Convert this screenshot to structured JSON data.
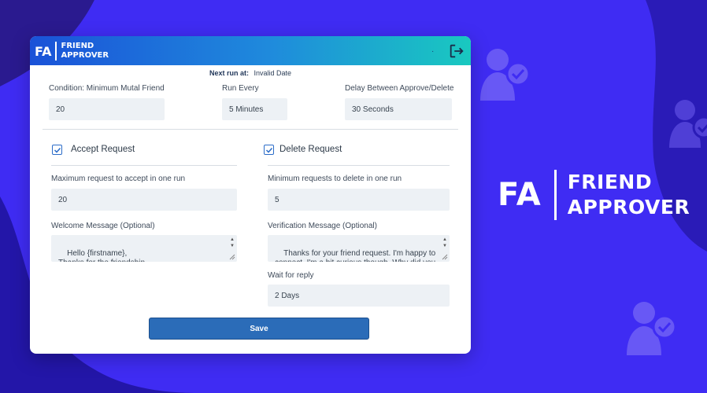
{
  "brand": {
    "initials": "FA",
    "line1": "FRIEND",
    "line2": "APPROVER"
  },
  "app": {
    "logo": {
      "initials": "FA",
      "line1": "FRIEND",
      "line2": "APPROVER"
    },
    "logout_icon": "logout-icon",
    "next_run": {
      "label": "Next run at:",
      "value": "Invalid Date"
    },
    "settings": {
      "condition_label": "Condition: Minimum Mutal Friend",
      "condition_value": "20",
      "run_every_label": "Run Every",
      "run_every_value": "5 Minutes",
      "delay_label": "Delay Between Approve/Delete",
      "delay_value": "30 Seconds"
    },
    "accept": {
      "checkbox_label": "Accept Request",
      "checked": true,
      "max_label": "Maximum request to accept in one run",
      "max_value": "20",
      "message_label": "Welcome Message (Optional)",
      "message_value": "Hello {firstname},\nThanks for the friendship\nHow are you doing?"
    },
    "delete": {
      "checkbox_label": "Delete Request",
      "checked": true,
      "min_label": "Minimum requests to delete in one run",
      "min_value": "5",
      "message_label": "Verification Message (Optional)",
      "message_value": "Thanks for your friend request. I'm happy to connect. I'm a bit curious though. Why did you send me a friend request? Just wondering",
      "wait_label": "Wait for reply",
      "wait_value": "2 Days"
    },
    "save_label": "Save"
  },
  "colors": {
    "background": "#3f2cf3",
    "dark_corner": "#2a1a8f",
    "accent": "#2b6cb8",
    "titlebar_start": "#1a52d8",
    "titlebar_end": "#19c9c0"
  }
}
